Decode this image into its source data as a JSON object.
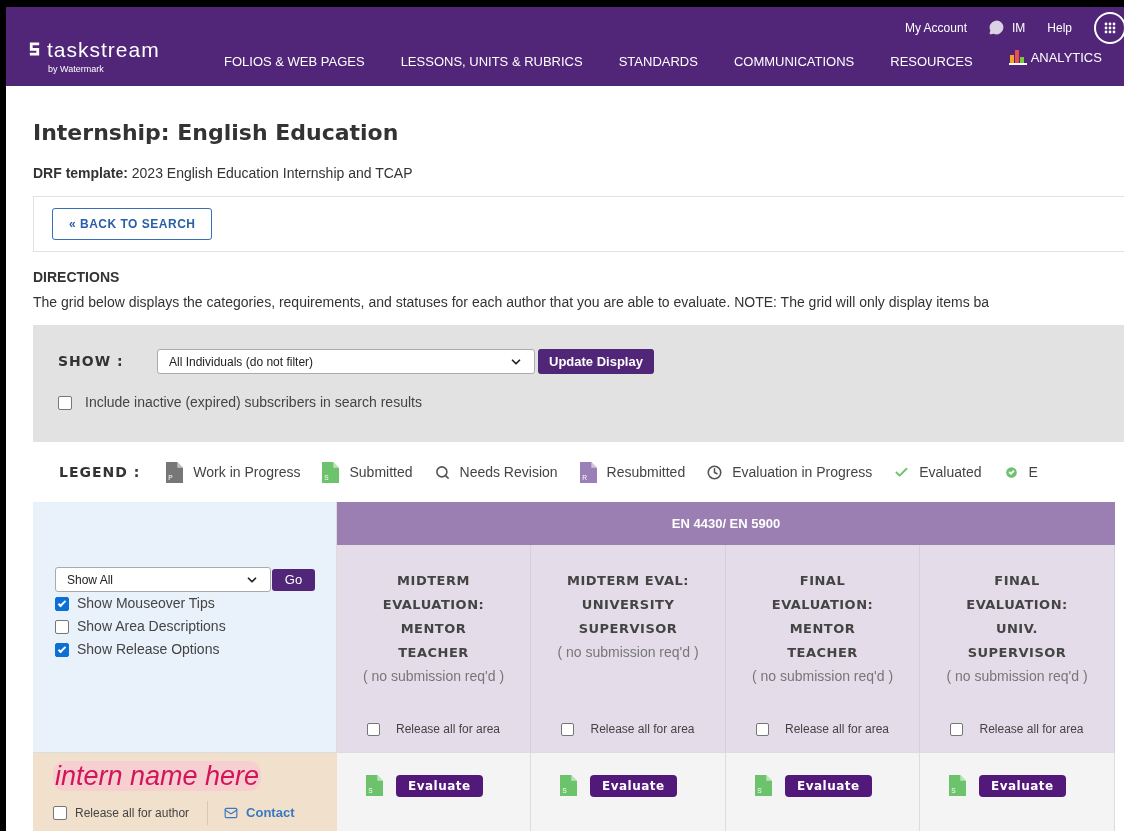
{
  "header": {
    "logo": {
      "name": "taskstream",
      "tagline": "by Watermark"
    },
    "top_links": [
      {
        "kind": "link",
        "label": "My Account"
      },
      {
        "kind": "chat",
        "label": "IM"
      },
      {
        "kind": "link",
        "label": "Help"
      }
    ],
    "nav": [
      {
        "kind": "text",
        "label": "FOLIOS & WEB PAGES"
      },
      {
        "kind": "text",
        "label": "LESSONS, UNITS & RUBRICS"
      },
      {
        "kind": "text",
        "label": "STANDARDS"
      },
      {
        "kind": "text",
        "label": "COMMUNICATIONS"
      },
      {
        "kind": "text",
        "label": "RESOURCES"
      },
      {
        "kind": "analytics",
        "label": "ANALYTICS"
      }
    ]
  },
  "page": {
    "title": "Internship: English Education",
    "template_label": "DRF template:",
    "template_value": "2023 English Education Internship and TCAP",
    "back_button": "« BACK TO SEARCH",
    "directions_heading": "DIRECTIONS",
    "directions_text": "The grid below displays the categories, requirements, and statuses for each author that you are able to evaluate. NOTE: The grid will only display items ba"
  },
  "filter": {
    "label": "SHOW :",
    "select_value": "All Individuals (do not filter)",
    "button": "Update Display",
    "include_inactive": {
      "label": "Include inactive (expired) subscribers in search results",
      "checked": false
    }
  },
  "legend": {
    "label": "LEGEND :",
    "items": [
      {
        "kind": "doc",
        "color": "#777777",
        "letter": "P",
        "label": "Work in Progress"
      },
      {
        "kind": "doc",
        "color": "#6cc36c",
        "letter": "S",
        "label": "Submitted"
      },
      {
        "kind": "search",
        "color": "#555555",
        "label": "Needs Revision"
      },
      {
        "kind": "doc",
        "color": "#9b7fb8",
        "letter": "R",
        "label": "Resubmitted"
      },
      {
        "kind": "clock",
        "color": "#555555",
        "label": "Evaluation in Progress"
      },
      {
        "kind": "check",
        "color": "#6cc36c",
        "label": "Evaluated"
      },
      {
        "kind": "check-circle",
        "color": "#6cc36c",
        "label": "E"
      }
    ]
  },
  "grid": {
    "group": "EN 4430/ EN 5900",
    "controls": {
      "select_value": "Show All",
      "go_button": "Go",
      "options": [
        {
          "label": "Show Mouseover Tips",
          "checked": true
        },
        {
          "label": "Show Area Descriptions",
          "checked": false
        },
        {
          "label": "Show Release Options",
          "checked": true
        }
      ]
    },
    "columns": [
      {
        "title": "MIDTERM EVALUATION: MENTOR TEACHER",
        "note": "( no submission req'd )",
        "release": {
          "label": "Release all for area",
          "checked": false
        }
      },
      {
        "title": "MIDTERM EVAL: UNIVERSITY SUPERVISOR",
        "note": "( no submission req'd )",
        "release": {
          "label": "Release all for area",
          "checked": false
        }
      },
      {
        "title": "FINAL EVALUATION: MENTOR TEACHER",
        "note": "( no submission req'd )",
        "release": {
          "label": "Release all for area",
          "checked": false
        }
      },
      {
        "title": "FINAL EVALUATION: UNIV. SUPERVISOR",
        "note": "( no submission req'd )",
        "release": {
          "label": "Release all for area",
          "checked": false
        }
      }
    ],
    "authors": [
      {
        "name": "intern name here",
        "release": {
          "label": "Release all for author",
          "checked": false
        },
        "contact": "Contact",
        "cells": [
          {
            "kind": "doc",
            "color": "#6cc36c",
            "letter": "S",
            "button": "Evaluate"
          },
          {
            "kind": "doc",
            "color": "#6cc36c",
            "letter": "S",
            "button": "Evaluate"
          },
          {
            "kind": "doc",
            "color": "#6cc36c",
            "letter": "S",
            "button": "Evaluate"
          },
          {
            "kind": "doc",
            "color": "#6cc36c",
            "letter": "S",
            "button": "Evaluate"
          }
        ]
      }
    ]
  }
}
